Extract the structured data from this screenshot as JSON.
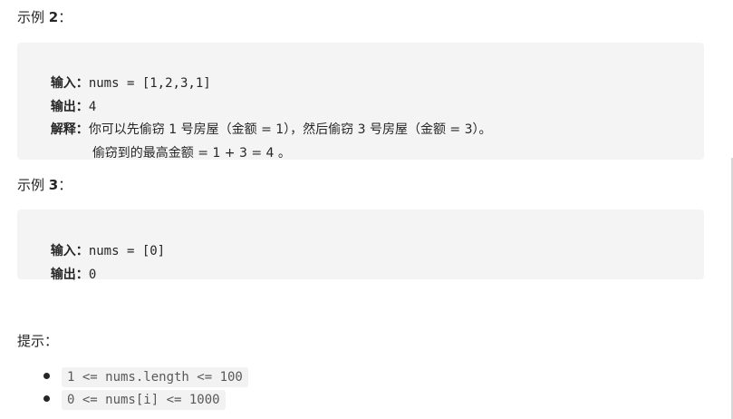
{
  "example2": {
    "heading": "示例",
    "number": "2",
    "colon": "：",
    "input_label": "输入：",
    "input_value": "nums = [1,2,3,1]",
    "output_label": "输出：",
    "output_value": "4",
    "explain_label": "解释：",
    "explain_line1": "你可以先偷窃 1 号房屋（金额 = 1），然后偷窃 3 号房屋（金额 = 3）。",
    "explain_line2": "偷窃到的最高金额 = 1 + 3 = 4 。"
  },
  "example3": {
    "heading": "示例",
    "number": "3",
    "colon": "：",
    "input_label": "输入：",
    "input_value": "nums = [0]",
    "output_label": "输出：",
    "output_value": "0"
  },
  "hints": {
    "title": "提示：",
    "items": [
      "1 <= nums.length <= 100",
      "0 <= nums[i] <= 1000"
    ]
  }
}
